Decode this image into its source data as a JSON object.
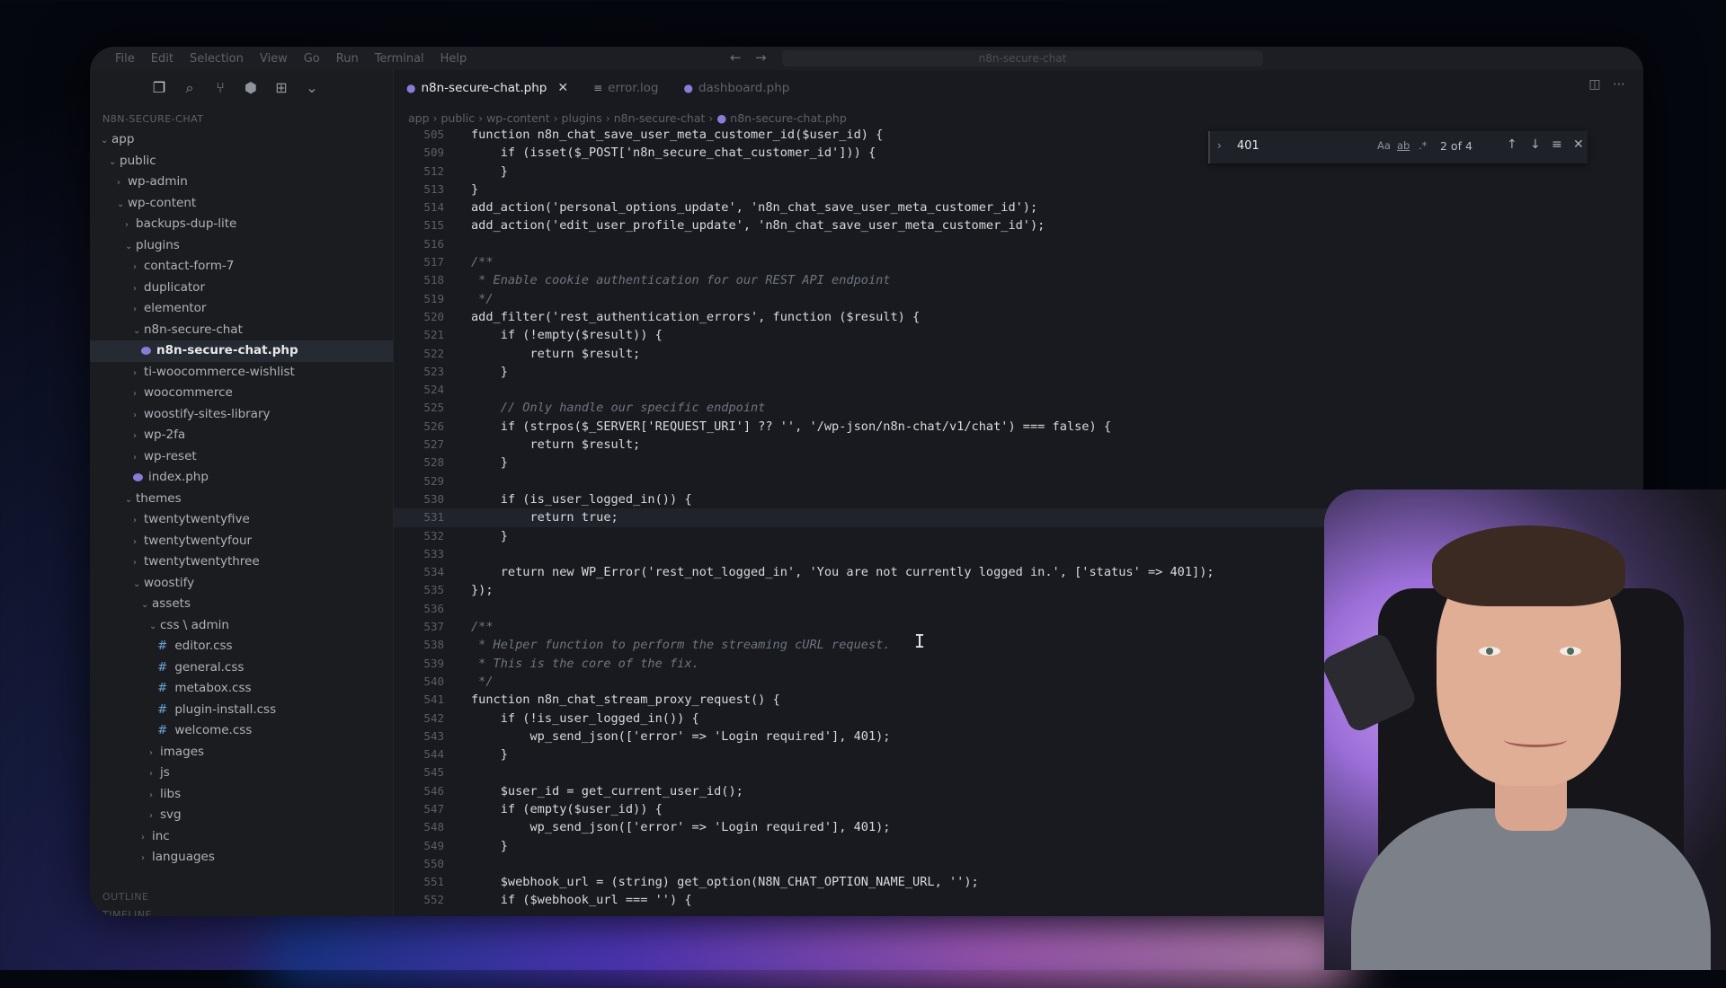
{
  "menu": [
    "File",
    "Edit",
    "Selection",
    "View",
    "Go",
    "Run",
    "Terminal",
    "Help"
  ],
  "command_center": "n8n-secure-chat",
  "explorer_title": "N8N-SECURE-CHAT",
  "tree": [
    {
      "label": "app",
      "indent": 0,
      "type": "folder-open"
    },
    {
      "label": "public",
      "indent": 1,
      "type": "folder-open"
    },
    {
      "label": "wp-admin",
      "indent": 2,
      "type": "folder"
    },
    {
      "label": "wp-content",
      "indent": 2,
      "type": "folder-open"
    },
    {
      "label": "backups-dup-lite",
      "indent": 3,
      "type": "folder"
    },
    {
      "label": "plugins",
      "indent": 3,
      "type": "folder-open"
    },
    {
      "label": "contact-form-7",
      "indent": 4,
      "type": "folder"
    },
    {
      "label": "duplicator",
      "indent": 4,
      "type": "folder"
    },
    {
      "label": "elementor",
      "indent": 4,
      "type": "folder"
    },
    {
      "label": "n8n-secure-chat",
      "indent": 4,
      "type": "folder-open"
    },
    {
      "label": "n8n-secure-chat.php",
      "indent": 5,
      "type": "php",
      "active": true
    },
    {
      "label": "ti-woocommerce-wishlist",
      "indent": 4,
      "type": "folder"
    },
    {
      "label": "woocommerce",
      "indent": 4,
      "type": "folder"
    },
    {
      "label": "woostify-sites-library",
      "indent": 4,
      "type": "folder"
    },
    {
      "label": "wp-2fa",
      "indent": 4,
      "type": "folder"
    },
    {
      "label": "wp-reset",
      "indent": 4,
      "type": "folder"
    },
    {
      "label": "index.php",
      "indent": 4,
      "type": "php"
    },
    {
      "label": "themes",
      "indent": 3,
      "type": "folder-open"
    },
    {
      "label": "twentytwentyfive",
      "indent": 4,
      "type": "folder"
    },
    {
      "label": "twentytwentyfour",
      "indent": 4,
      "type": "folder"
    },
    {
      "label": "twentytwentythree",
      "indent": 4,
      "type": "folder"
    },
    {
      "label": "woostify",
      "indent": 4,
      "type": "folder-open"
    },
    {
      "label": "assets",
      "indent": 5,
      "type": "folder-open"
    },
    {
      "label": "css \\ admin",
      "indent": 6,
      "type": "folder-open"
    },
    {
      "label": "editor.css",
      "indent": 7,
      "type": "css"
    },
    {
      "label": "general.css",
      "indent": 7,
      "type": "css"
    },
    {
      "label": "metabox.css",
      "indent": 7,
      "type": "css"
    },
    {
      "label": "plugin-install.css",
      "indent": 7,
      "type": "css"
    },
    {
      "label": "welcome.css",
      "indent": 7,
      "type": "css"
    },
    {
      "label": "images",
      "indent": 6,
      "type": "folder"
    },
    {
      "label": "js",
      "indent": 6,
      "type": "folder"
    },
    {
      "label": "libs",
      "indent": 6,
      "type": "folder"
    },
    {
      "label": "svg",
      "indent": 6,
      "type": "folder"
    },
    {
      "label": "inc",
      "indent": 5,
      "type": "folder"
    },
    {
      "label": "languages",
      "indent": 5,
      "type": "folder"
    }
  ],
  "outline_label": "OUTLINE",
  "timeline_label": "TIMELINE",
  "tabs": [
    {
      "label": "n8n-secure-chat.php",
      "active": true
    },
    {
      "label": "error.log",
      "active": false
    },
    {
      "label": "dashboard.php",
      "active": false
    }
  ],
  "breadcrumb": [
    "app",
    "public",
    "wp-content",
    "plugins",
    "n8n-secure-chat",
    "n8n-secure-chat.php"
  ],
  "find": {
    "query": "401",
    "case_label": "Aa",
    "word_label": "ab",
    "count": "2 of 4"
  },
  "code_lines": [
    {
      "n": "505",
      "t": "function n8n_chat_save_user_meta_customer_id($user_id) {"
    },
    {
      "n": "509",
      "t": "    if (isset($_POST['n8n_secure_chat_customer_id'])) {"
    },
    {
      "n": "512",
      "t": "    }"
    },
    {
      "n": "513",
      "t": "}"
    },
    {
      "n": "514",
      "t": "add_action('personal_options_update', 'n8n_chat_save_user_meta_customer_id');"
    },
    {
      "n": "515",
      "t": "add_action('edit_user_profile_update', 'n8n_chat_save_user_meta_customer_id');"
    },
    {
      "n": "516",
      "t": ""
    },
    {
      "n": "517",
      "t": "/**",
      "c": true
    },
    {
      "n": "518",
      "t": " * Enable cookie authentication for our REST API endpoint",
      "c": true
    },
    {
      "n": "519",
      "t": " */",
      "c": true
    },
    {
      "n": "520",
      "t": "add_filter('rest_authentication_errors', function ($result) {"
    },
    {
      "n": "521",
      "t": "    if (!empty($result)) {"
    },
    {
      "n": "522",
      "t": "        return $result;"
    },
    {
      "n": "523",
      "t": "    }"
    },
    {
      "n": "524",
      "t": ""
    },
    {
      "n": "525",
      "t": "    // Only handle our specific endpoint",
      "c": true
    },
    {
      "n": "526",
      "t": "    if (strpos($_SERVER['REQUEST_URI'] ?? '', '/wp-json/n8n-chat/v1/chat') === false) {"
    },
    {
      "n": "527",
      "t": "        return $result;"
    },
    {
      "n": "528",
      "t": "    }"
    },
    {
      "n": "529",
      "t": ""
    },
    {
      "n": "530",
      "t": "    if (is_user_logged_in()) {"
    },
    {
      "n": "531",
      "t": "        return true;",
      "cur": true
    },
    {
      "n": "532",
      "t": "    }"
    },
    {
      "n": "533",
      "t": ""
    },
    {
      "n": "534",
      "t": "    return new WP_Error('rest_not_logged_in', 'You are not currently logged in.', ['status' => 401]);"
    },
    {
      "n": "535",
      "t": "});"
    },
    {
      "n": "536",
      "t": ""
    },
    {
      "n": "537",
      "t": "/**",
      "c": true
    },
    {
      "n": "538",
      "t": " * Helper function to perform the streaming cURL request.",
      "c": true
    },
    {
      "n": "539",
      "t": " * This is the core of the fix.",
      "c": true
    },
    {
      "n": "540",
      "t": " */",
      "c": true
    },
    {
      "n": "541",
      "t": "function n8n_chat_stream_proxy_request() {"
    },
    {
      "n": "542",
      "t": "    if (!is_user_logged_in()) {"
    },
    {
      "n": "543",
      "t": "        wp_send_json(['error' => 'Login required'], 401);"
    },
    {
      "n": "544",
      "t": "    }"
    },
    {
      "n": "545",
      "t": ""
    },
    {
      "n": "546",
      "t": "    $user_id = get_current_user_id();"
    },
    {
      "n": "547",
      "t": "    if (empty($user_id)) {"
    },
    {
      "n": "548",
      "t": "        wp_send_json(['error' => 'Login required'], 401);"
    },
    {
      "n": "549",
      "t": "    }"
    },
    {
      "n": "550",
      "t": ""
    },
    {
      "n": "551",
      "t": "    $webhook_url = (string) get_option(N8N_CHAT_OPTION_NAME_URL, '');"
    },
    {
      "n": "552",
      "t": "    if ($webhook_url === '') {"
    }
  ],
  "colors": {
    "accent": "#8a7bd6",
    "comment": "#6e7480",
    "text": "#d8dade"
  }
}
